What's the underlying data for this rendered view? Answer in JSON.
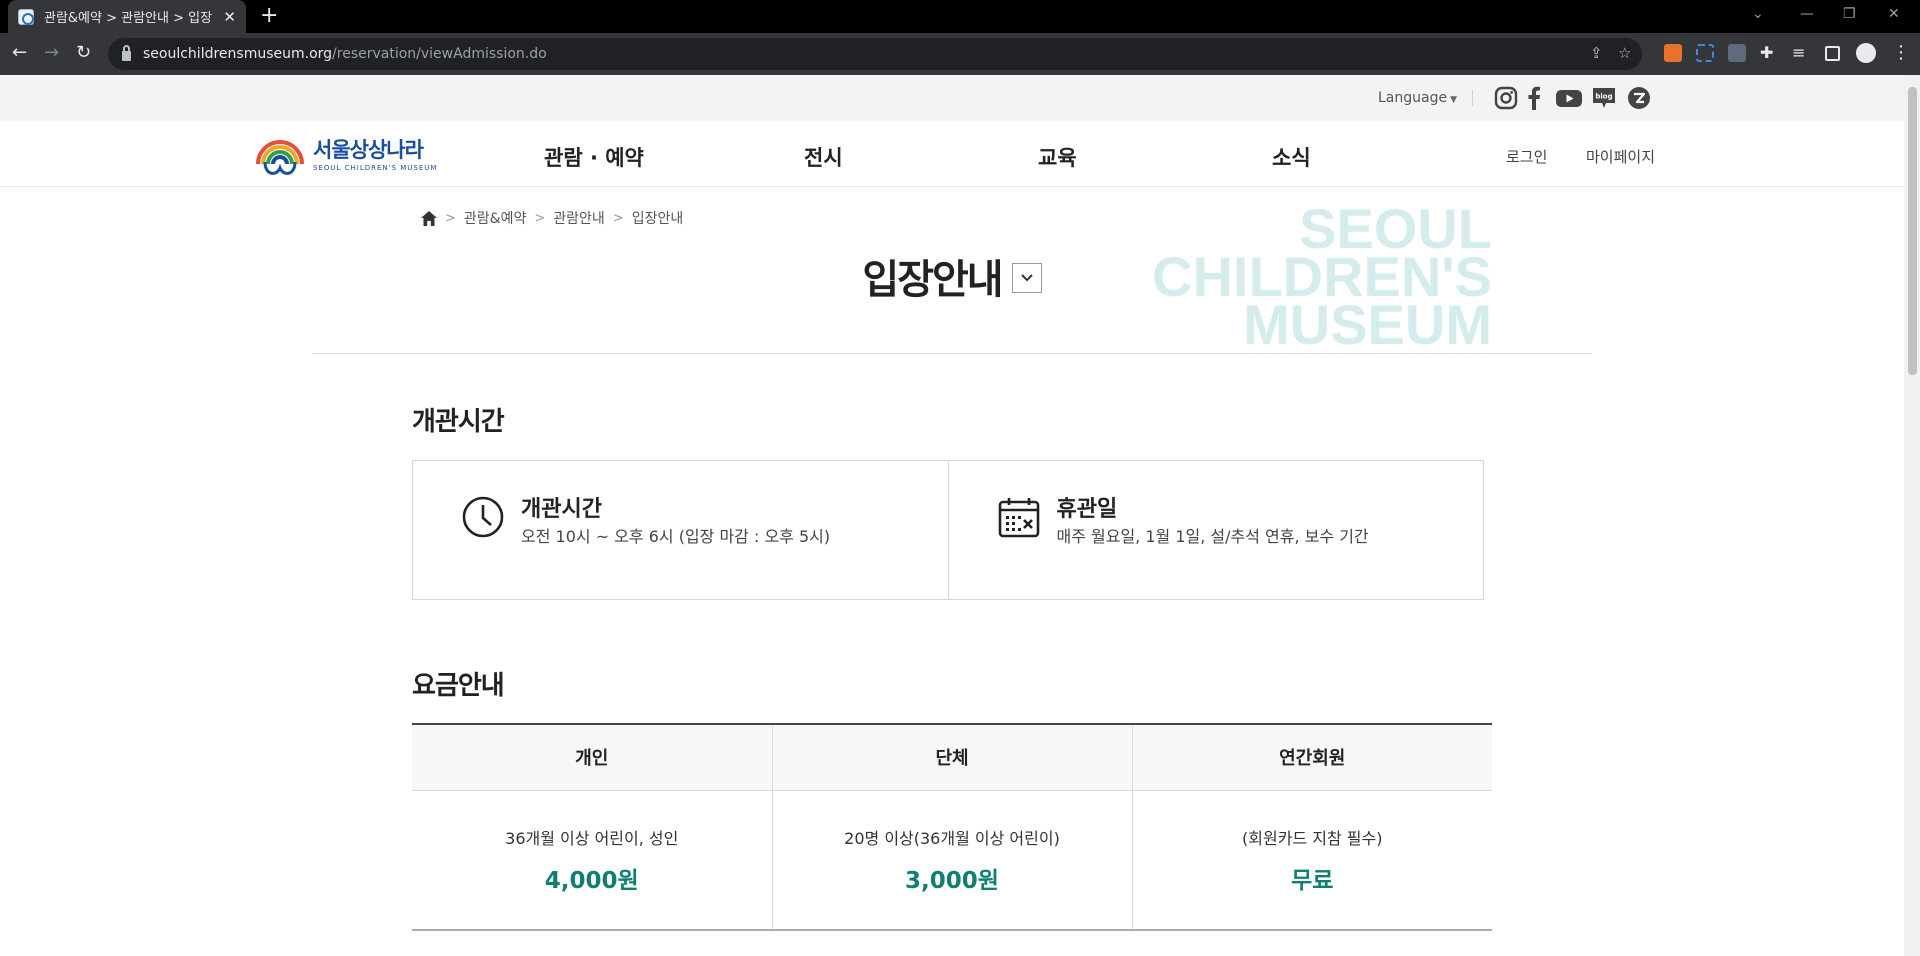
{
  "browser": {
    "tab_title": "관람&예약 > 관람안내 > 입장안",
    "url_host": "seoulchildrensmuseum.org",
    "url_path": "/reservation/viewAdmission.do"
  },
  "util": {
    "language": "Language",
    "sns": [
      "instagram-icon",
      "facebook-icon",
      "youtube-icon",
      "blog-icon",
      "zum-icon"
    ]
  },
  "logo": {
    "kr": "서울상상나라",
    "en": "SEOUL CHILDREN'S MUSEUM"
  },
  "gnb": {
    "menu": [
      "관람 · 예약",
      "전시",
      "교육",
      "소식"
    ],
    "login": "로그인",
    "mypage": "마이페이지"
  },
  "breadcrumb": [
    "관람&예약",
    "관람안내",
    "입장안내"
  ],
  "page": {
    "title": "입장안내",
    "watermark": [
      "SEOUL",
      "CHILDREN'S",
      "MUSEUM"
    ]
  },
  "hours": {
    "section_title": "개관시간",
    "items": [
      {
        "label": "개관시간",
        "desc": "오전 10시 ~ 오후 6시 (입장 마감 : 오후 5시)",
        "icon": "clock-icon"
      },
      {
        "label": "휴관일",
        "desc": "매주 월요일, 1월 1일, 설/추석 연휴, 보수 기간",
        "icon": "calendar-icon"
      }
    ]
  },
  "fees": {
    "section_title": "요금안내",
    "columns": [
      "개인",
      "단체",
      "연간회원"
    ],
    "rows": [
      {
        "desc": "36개월 이상 어린이, 성인",
        "price": "4,000원"
      },
      {
        "desc": "20명 이상(36개월 이상 어린이)",
        "price": "3,000원"
      },
      {
        "desc": "(회원카드 지참 필수)",
        "price": "무료"
      }
    ]
  },
  "colors": {
    "accent": "#0f7f73",
    "watermark": "#d5eced",
    "logo_blue": "#1a4f9c"
  }
}
